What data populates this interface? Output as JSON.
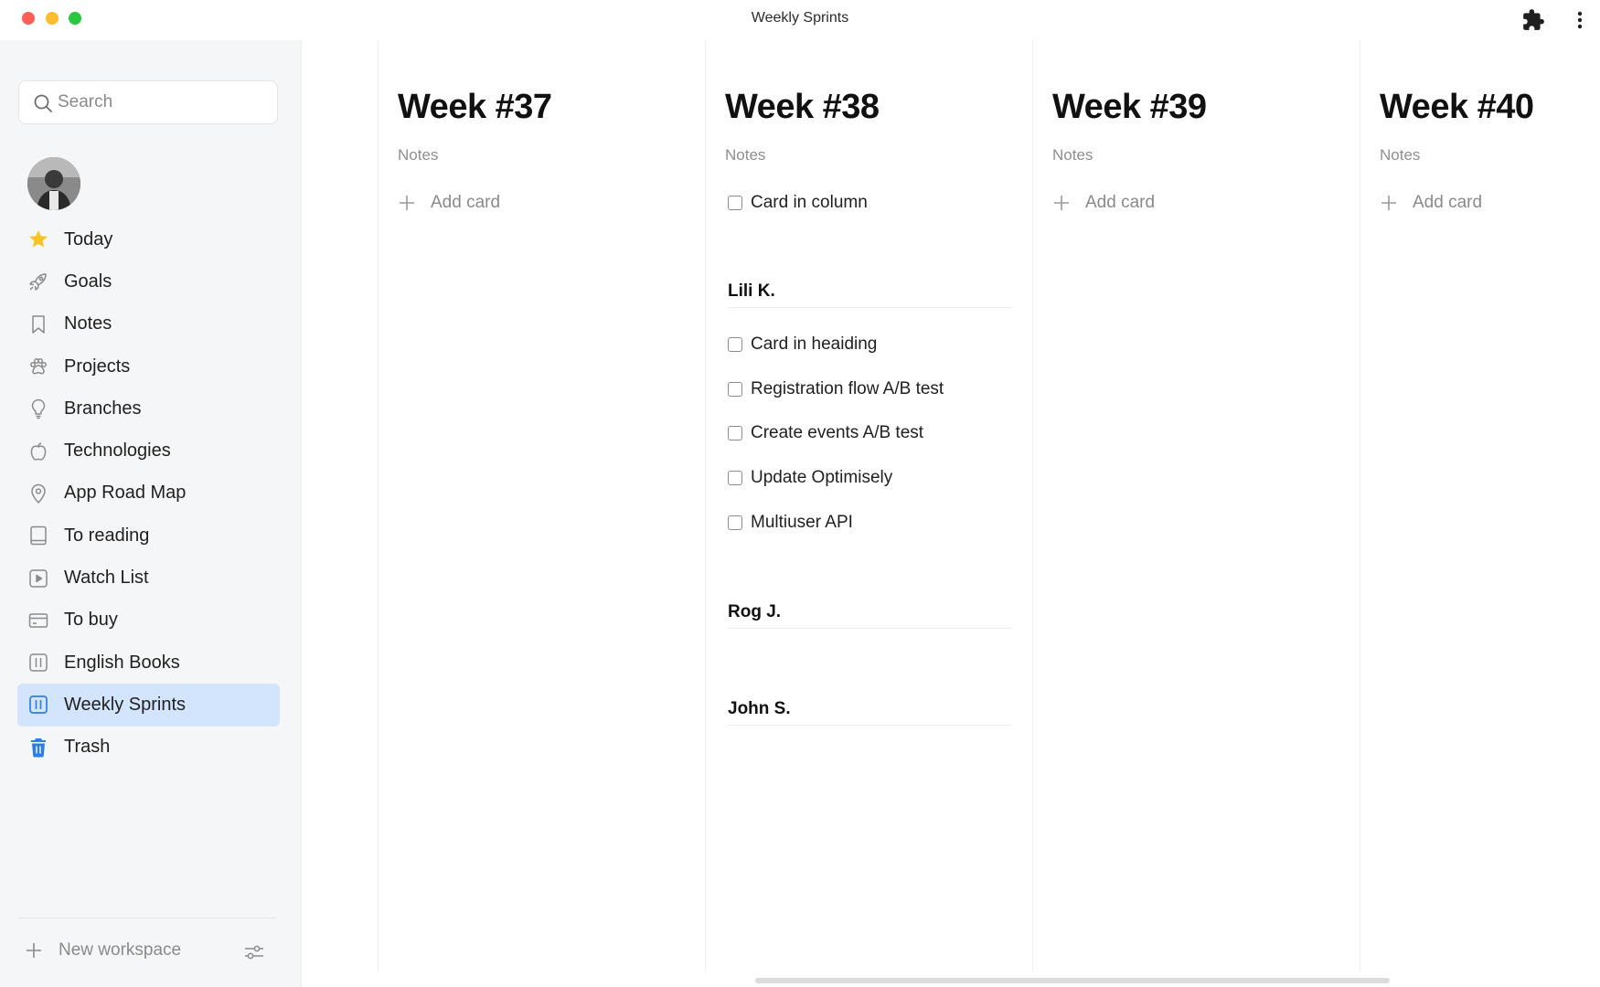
{
  "window": {
    "title": "Weekly Sprints"
  },
  "sidebar": {
    "search_placeholder": "Search",
    "items": [
      {
        "label": "Today",
        "icon": "star-icon"
      },
      {
        "label": "Goals",
        "icon": "rocket-icon"
      },
      {
        "label": "Notes",
        "icon": "bookmark-icon"
      },
      {
        "label": "Projects",
        "icon": "paw-icon"
      },
      {
        "label": "Branches",
        "icon": "lightbulb-icon"
      },
      {
        "label": "Technologies",
        "icon": "apple-icon"
      },
      {
        "label": "App Road Map",
        "icon": "map-pin-icon"
      },
      {
        "label": "To reading",
        "icon": "book-icon"
      },
      {
        "label": "Watch List",
        "icon": "play-icon"
      },
      {
        "label": "To buy",
        "icon": "credit-card-icon"
      },
      {
        "label": "English Books",
        "icon": "board-icon"
      },
      {
        "label": "Weekly Sprints",
        "icon": "board-icon",
        "active": true
      },
      {
        "label": "Trash",
        "icon": "trash-icon"
      }
    ],
    "new_workspace_label": "New workspace"
  },
  "board": {
    "columns": [
      {
        "title": "Week #37",
        "notes": "Notes",
        "add_card": "Add card"
      },
      {
        "title": "Week #38",
        "notes": "Notes",
        "cards": [
          "Card in column"
        ],
        "headings": [
          {
            "title": "Lili K.",
            "cards": [
              "Card in heaiding",
              "Registration flow A/B test",
              "Create events A/B test",
              "Update Optimisely",
              "Multiuser API"
            ]
          },
          {
            "title": "Rog J.",
            "cards": []
          },
          {
            "title": "John S.",
            "cards": []
          }
        ]
      },
      {
        "title": "Week #39",
        "notes": "Notes",
        "add_card": "Add card"
      },
      {
        "title": "Week #40",
        "notes": "Notes",
        "add_card": "Add card"
      }
    ]
  },
  "colors": {
    "active_item_bg": "#d3e4fd",
    "accent_blue": "#2f7de1",
    "star_yellow": "#f7c325",
    "close_red": "#fe5f57",
    "minimize_yellow": "#febc2e",
    "maximize_green": "#28c840"
  }
}
